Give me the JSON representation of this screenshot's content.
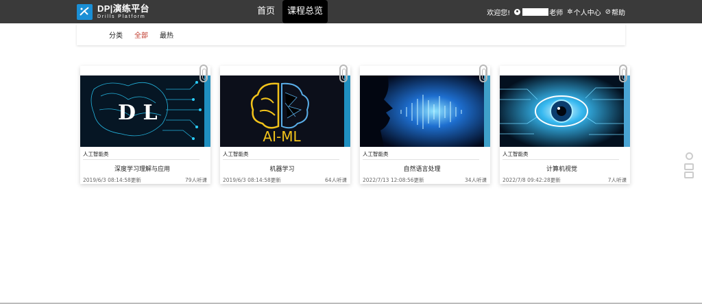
{
  "brand": {
    "title": "DP|演练平台",
    "subtitle": "Drills Platform"
  },
  "nav": {
    "home": "首页",
    "overview": "课程总览"
  },
  "user": {
    "welcome": "欢迎您!",
    "name_suffix": "老师",
    "center": "个人中心",
    "help": "帮助"
  },
  "filters": [
    "分类",
    "全部",
    "最热"
  ],
  "courses": [
    {
      "category": "人工智能类",
      "title": "深度学习理解与应用",
      "updated": "2019/6/3 08:14:58更新",
      "listeners": "79人听课",
      "image_label": "D L",
      "strip": "#1f8fc0"
    },
    {
      "category": "人工智能类",
      "title": "机器学习",
      "updated": "2019/6/3 08:14:58更新",
      "listeners": "64人听课",
      "image_label": "AI-ML",
      "strip": "#1f8fc0"
    },
    {
      "category": "人工智能类",
      "title": "自然语言处理",
      "updated": "2022/7/13 12:08:56更新",
      "listeners": "34人听课",
      "image_label": "",
      "strip": "#3fa0c9"
    },
    {
      "category": "人工智能类",
      "title": "计算机视觉",
      "updated": "2022/7/8 09:42:28更新",
      "listeners": "7人听课",
      "image_label": "",
      "strip": "#4aa4d4"
    }
  ],
  "colors": {
    "nav_bg": "#3a3a3a",
    "active_filter": "#c0392b",
    "brand_blue": "#1a8fd6"
  }
}
